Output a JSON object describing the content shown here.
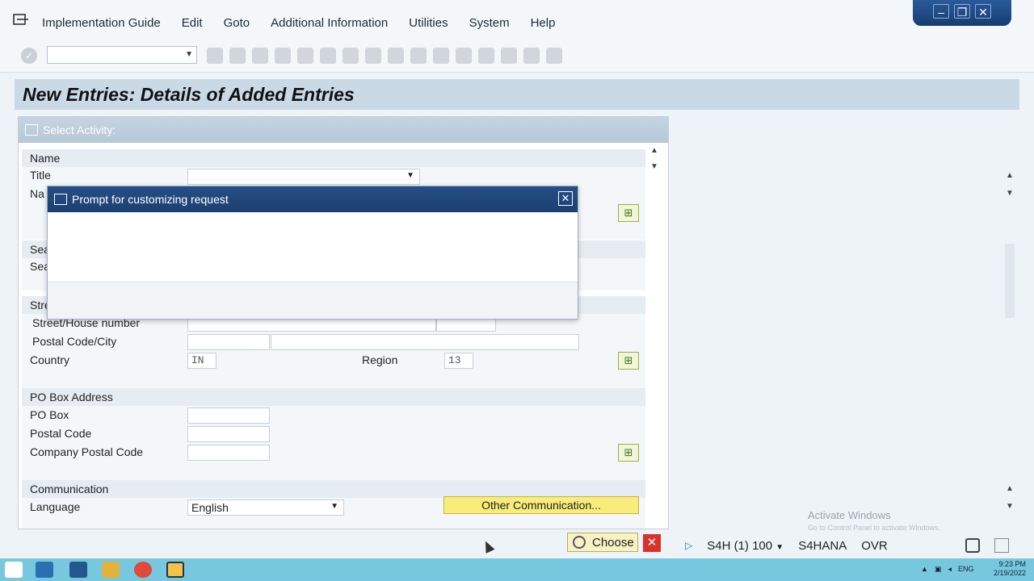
{
  "menubar": {
    "items": [
      "Implementation Guide",
      "Edit",
      "Goto",
      "Additional Information",
      "Utilities",
      "System",
      "Help"
    ]
  },
  "page": {
    "title": "New Entries: Details of Added Entries"
  },
  "panel": {
    "header": "Select Activity:"
  },
  "sections": {
    "name": {
      "title": "Name",
      "title_label": "Title",
      "name_label_partial": "Na"
    },
    "search": {
      "title_partial": "Sea",
      "label_partial": "Sea"
    },
    "street": {
      "title_partial": "Stre",
      "street_label": "Street/House number",
      "postal_label": "Postal Code/City",
      "country_label": "Country",
      "country_value": "IN",
      "region_label": "Region",
      "region_value": "13"
    },
    "pobox": {
      "title": "PO Box Address",
      "pobox_label": "PO Box",
      "postal_label": "Postal Code",
      "company_postal_label": "Company Postal Code"
    },
    "communication": {
      "title": "Communication",
      "language_label": "Language",
      "language_value": "English",
      "other_button": "Other Communication..."
    }
  },
  "modal": {
    "title": "Prompt for customizing request"
  },
  "actions": {
    "choose_label": "Choose"
  },
  "status": {
    "system": "S4H (1) 100",
    "server": "S4HANA",
    "mode": "OVR"
  },
  "watermark": {
    "line1": "Activate Windows",
    "line2": "Go to Control Panel to activate Windows."
  },
  "tray": {
    "lang": "ENG",
    "time": "9:23 PM",
    "date": "2/19/2022"
  }
}
